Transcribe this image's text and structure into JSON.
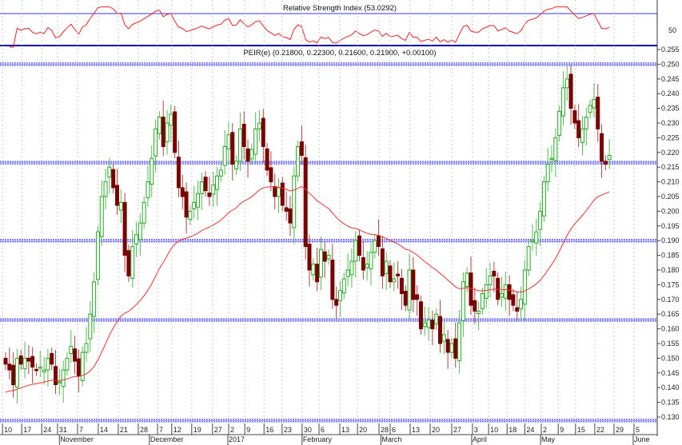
{
  "chart_data": {
    "type": "candlestick",
    "title": "PEIR(e) (0.21800, 0.22300, 0.21600, 0.21900, +0.00100)",
    "rsi_title": "Relative Strength Index (53.0292)",
    "rsi_tick_label": "50",
    "ylim": [
      0.1275,
      0.2575
    ],
    "yticks": [
      "0.130",
      "0.135",
      "0.140",
      "0.145",
      "0.150",
      "0.155",
      "0.160",
      "0.165",
      "0.170",
      "0.175",
      "0.180",
      "0.185",
      "0.190",
      "0.195",
      "0.200",
      "0.205",
      "0.210",
      "0.215",
      "0.220",
      "0.225",
      "0.230",
      "0.235",
      "0.240",
      "0.245",
      "0.250",
      "0.255"
    ],
    "hlines": [
      0.25,
      0.2165,
      0.19,
      0.163,
      0.1288
    ],
    "closes": [
      0.148,
      0.146,
      0.141,
      0.15,
      0.148,
      0.15,
      0.149,
      0.147,
      0.146,
      0.147,
      0.146,
      0.15,
      0.148,
      0.141,
      0.142,
      0.146,
      0.15,
      0.154,
      0.149,
      0.144,
      0.152,
      0.155,
      0.165,
      0.176,
      0.193,
      0.205,
      0.21,
      0.215,
      0.208,
      0.202,
      0.203,
      0.185,
      0.178,
      0.188,
      0.192,
      0.196,
      0.203,
      0.21,
      0.218,
      0.228,
      0.232,
      0.222,
      0.23,
      0.233,
      0.22,
      0.208,
      0.205,
      0.198,
      0.2,
      0.203,
      0.206,
      0.21,
      0.207,
      0.205,
      0.209,
      0.212,
      0.214,
      0.222,
      0.226,
      0.216,
      0.217,
      0.228,
      0.222,
      0.217,
      0.221,
      0.228,
      0.23,
      0.222,
      0.214,
      0.21,
      0.205,
      0.208,
      0.202,
      0.2,
      0.196,
      0.212,
      0.222,
      0.219,
      0.188,
      0.18,
      0.182,
      0.176,
      0.187,
      0.183,
      0.185,
      0.17,
      0.168,
      0.173,
      0.177,
      0.18,
      0.183,
      0.19,
      0.185,
      0.18,
      0.182,
      0.186,
      0.19,
      0.188,
      0.178,
      0.183,
      0.176,
      0.177,
      0.178,
      0.172,
      0.168,
      0.18,
      0.17,
      0.17,
      0.16,
      0.162,
      0.163,
      0.16,
      0.165,
      0.155,
      0.158,
      0.152,
      0.155,
      0.15,
      0.162,
      0.176,
      0.179,
      0.168,
      0.166,
      0.166,
      0.172,
      0.175,
      0.178,
      0.178,
      0.17,
      0.172,
      0.175,
      0.17,
      0.168,
      0.166,
      0.17,
      0.18,
      0.188,
      0.19,
      0.193,
      0.2,
      0.21,
      0.216,
      0.218,
      0.225,
      0.234,
      0.242,
      0.245,
      0.235,
      0.23,
      0.225,
      0.228,
      0.232,
      0.236,
      0.238,
      0.228,
      0.217,
      0.216,
      0.219
    ],
    "xticks": [
      {
        "label": "10",
        "i": -0.8
      },
      {
        "label": "17",
        "i": 4.2
      },
      {
        "label": "24",
        "i": 9.4
      },
      {
        "label": "31",
        "i": 13.5
      },
      {
        "label": "7",
        "i": 18.7
      },
      {
        "label": "14",
        "i": 24.1
      },
      {
        "label": "21",
        "i": 29.3
      },
      {
        "label": "28",
        "i": 34.5
      },
      {
        "label": "7",
        "i": 39.5
      },
      {
        "label": "12",
        "i": 43.2
      },
      {
        "label": "19",
        "i": 48.4
      },
      {
        "label": "27",
        "i": 53.8
      },
      {
        "label": "2",
        "i": 58
      },
      {
        "label": "9",
        "i": 62.2
      },
      {
        "label": "16",
        "i": 67.2
      },
      {
        "label": "23",
        "i": 71.9
      },
      {
        "label": "30",
        "i": 77.1
      },
      {
        "label": "6",
        "i": 81.5
      },
      {
        "label": "13",
        "i": 86.9
      },
      {
        "label": "20",
        "i": 91.5
      },
      {
        "label": "28",
        "i": 97.1
      },
      {
        "label": "6",
        "i": 100
      },
      {
        "label": "13",
        "i": 105.2
      },
      {
        "label": "20",
        "i": 110.4
      },
      {
        "label": "27",
        "i": 116
      },
      {
        "label": "3",
        "i": 121.4
      },
      {
        "label": "10",
        "i": 125.6
      },
      {
        "label": "18",
        "i": 130.4
      },
      {
        "label": "24",
        "i": 135
      },
      {
        "label": "2",
        "i": 139.3
      },
      {
        "label": "9",
        "i": 143.7
      },
      {
        "label": "15",
        "i": 148.2
      },
      {
        "label": "22",
        "i": 153.2
      },
      {
        "label": "29",
        "i": 158.2
      },
      {
        "label": "5",
        "i": 163.4
      }
    ],
    "months": [
      {
        "label": "November",
        "i": 14.2
      },
      {
        "label": "December",
        "i": 37.6
      },
      {
        "label": "2017",
        "i": 58
      },
      {
        "label": "February",
        "i": 77.3
      },
      {
        "label": "March",
        "i": 97.8
      },
      {
        "label": "April",
        "i": 121.4
      },
      {
        "label": "May",
        "i": 139.3
      },
      {
        "label": "June",
        "i": 163.4
      }
    ],
    "colors": {
      "up": "#22aa22",
      "down": "#7a0000",
      "ma": "#ee3333",
      "rsi": "#ee2222",
      "hline": "#3333ee",
      "grid": "#cccccc"
    }
  }
}
